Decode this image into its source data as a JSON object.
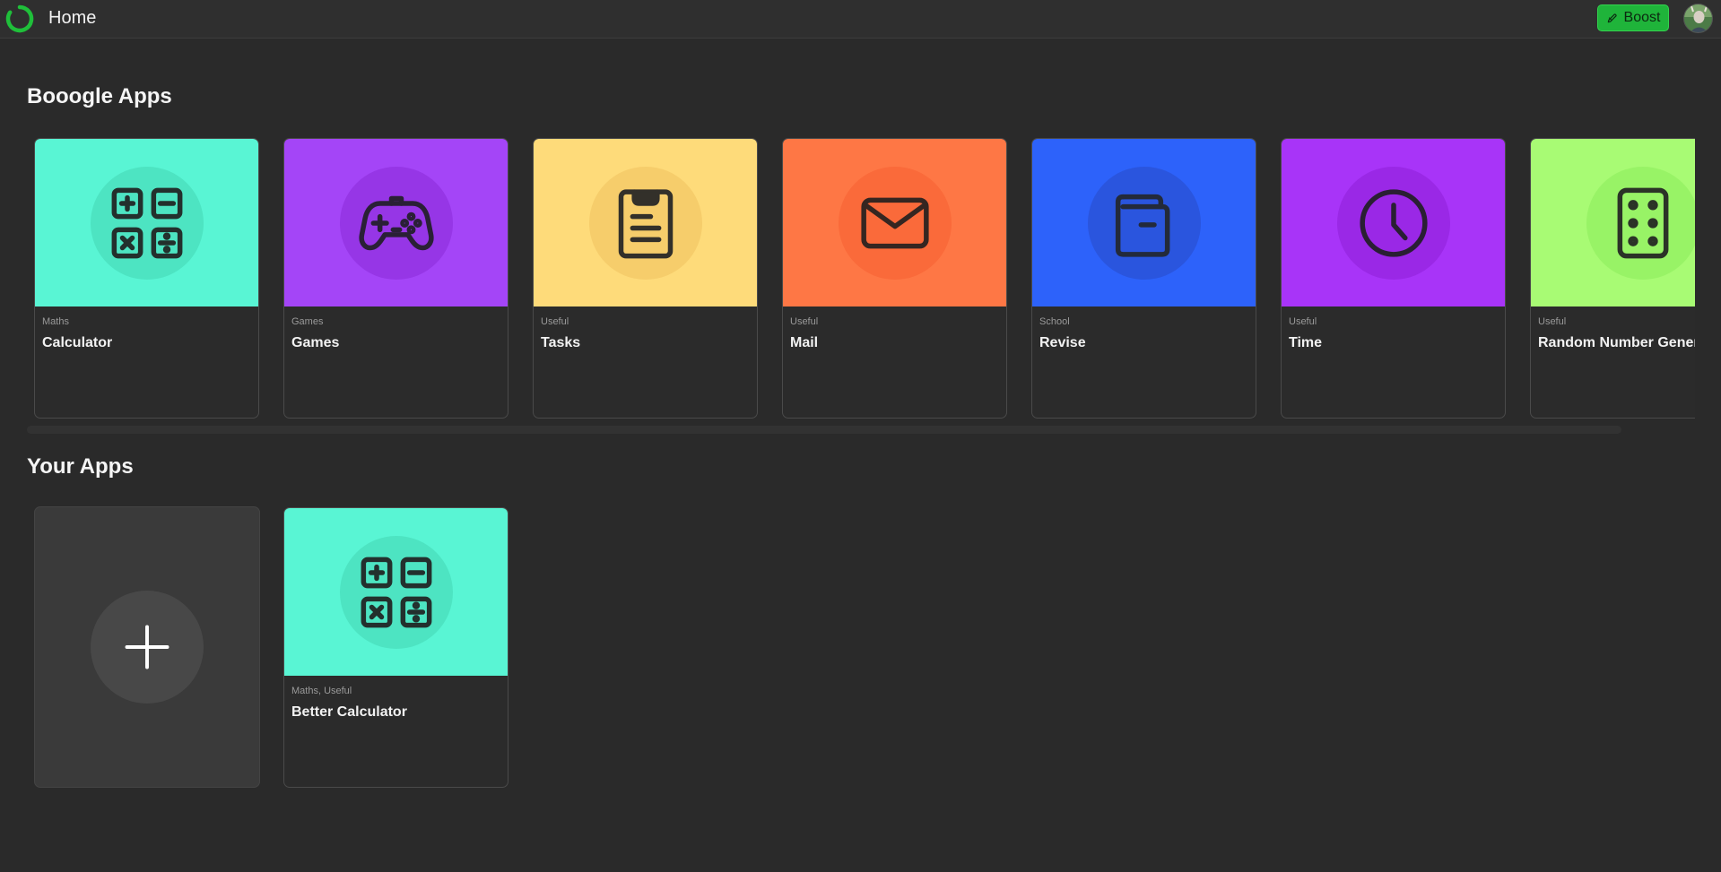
{
  "header": {
    "title": "Home",
    "boost_label": "Boost",
    "accent": "#1fb43a"
  },
  "booogle_apps": {
    "title": "Booogle Apps",
    "items": [
      {
        "category": "Maths",
        "name": "Calculator",
        "icon": "calculator-icon",
        "bg": "#59f5d4",
        "circle": "#4de4c2"
      },
      {
        "category": "Games",
        "name": "Games",
        "icon": "gamepad-icon",
        "bg": "#a445f7",
        "circle": "#9636e6"
      },
      {
        "category": "Useful",
        "name": "Tasks",
        "icon": "clipboard-icon",
        "bg": "#fedb7a",
        "circle": "#f6cd6b"
      },
      {
        "category": "Useful",
        "name": "Mail",
        "icon": "mail-icon",
        "bg": "#fe7745",
        "circle": "#fa6a3a"
      },
      {
        "category": "School",
        "name": "Revise",
        "icon": "book-icon",
        "bg": "#2d62fa",
        "circle": "#2a55de"
      },
      {
        "category": "Useful",
        "name": "Time",
        "icon": "clock-icon",
        "bg": "#a834f8",
        "circle": "#9a28e6"
      },
      {
        "category": "Useful",
        "name": "Random Number Genera",
        "icon": "dice-icon",
        "bg": "#a8fb74",
        "circle": "#98f366"
      }
    ]
  },
  "your_apps": {
    "title": "Your Apps",
    "add_icon": "plus-icon",
    "items": [
      {
        "category": "Maths, Useful",
        "name": "Better Calculator",
        "icon": "calculator-icon",
        "bg": "#59f5d4",
        "circle": "#4de4c2"
      }
    ]
  }
}
